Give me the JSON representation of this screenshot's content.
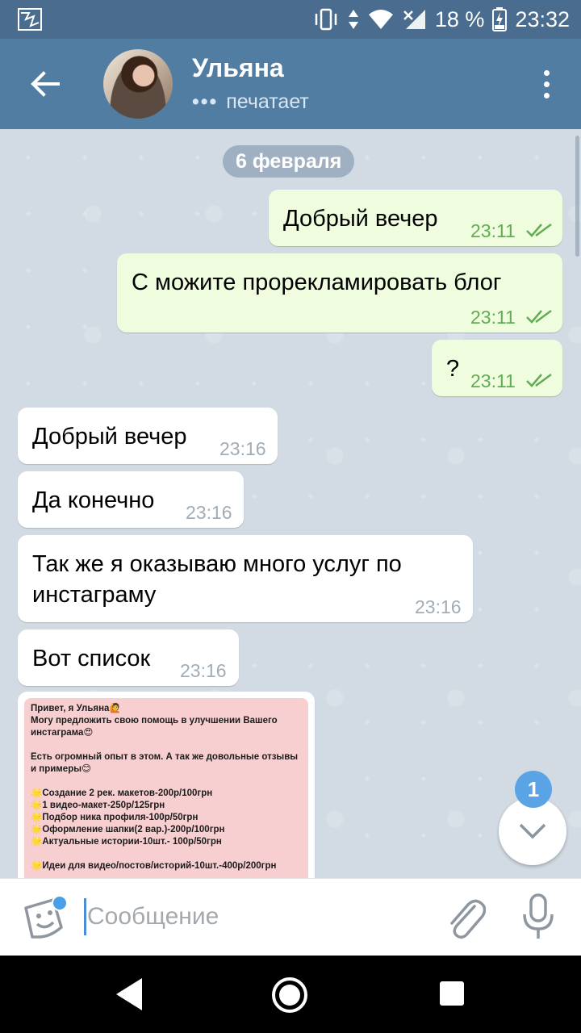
{
  "status_bar": {
    "battery": "18 %",
    "time": "23:32"
  },
  "header": {
    "contact_name": "Ульяна",
    "typing_dots": "•••",
    "status": "печатает"
  },
  "chat": {
    "date": "6 февраля",
    "messages": [
      {
        "dir": "out",
        "text": "Добрый вечер",
        "time": "23:11",
        "read": true
      },
      {
        "dir": "out",
        "text": "С можите прорекламировать блог",
        "time": "23:11",
        "read": true
      },
      {
        "dir": "out",
        "text": "?",
        "time": "23:11",
        "read": true
      },
      {
        "dir": "in",
        "text": "Добрый вечер",
        "time": "23:16"
      },
      {
        "dir": "in",
        "text": "Да конечно",
        "time": "23:16"
      },
      {
        "dir": "in",
        "text": "Так же я оказываю много услуг по инстаграму",
        "time": "23:16"
      },
      {
        "dir": "in",
        "text": "Вот список",
        "time": "23:16"
      }
    ],
    "image_message": {
      "line1": "Привет, я Ульяна🙋",
      "line2": "Могу предложить свою помощь в улучшении Вашего инстаграма😍",
      "line3": "Есть огромный опыт в этом. А так же довольные отзывы и примеры😊",
      "items": [
        "🌟Создание 2 рек. макетов-200р/100грн",
        "🌟1 видео-макет-250р/125грн",
        "🌟Подбор ника профиля-100р/50грн",
        "🌟Оформление шапки(2 вар.)-200р/100грн",
        "🌟Актуальные истории-10шт.- 100р/50грн"
      ],
      "line_last": "🌟Идеи для видео/постов/историй-10шт.-400р/200грн"
    },
    "unread_badge": "1"
  },
  "input": {
    "placeholder": "Сообщение"
  },
  "icons": {
    "back": "arrow-left-icon",
    "menu": "more-vertical-icon",
    "sticker": "sticker-icon",
    "attach": "paperclip-icon",
    "mic": "microphone-icon",
    "scroll_down": "chevron-down-icon"
  },
  "colors": {
    "header": "#527da3",
    "status_bar": "#4a6d8f",
    "outgoing_bubble": "#effdde",
    "incoming_bubble": "#ffffff",
    "outgoing_time": "#62ac55",
    "badge": "#5aa4e6"
  }
}
